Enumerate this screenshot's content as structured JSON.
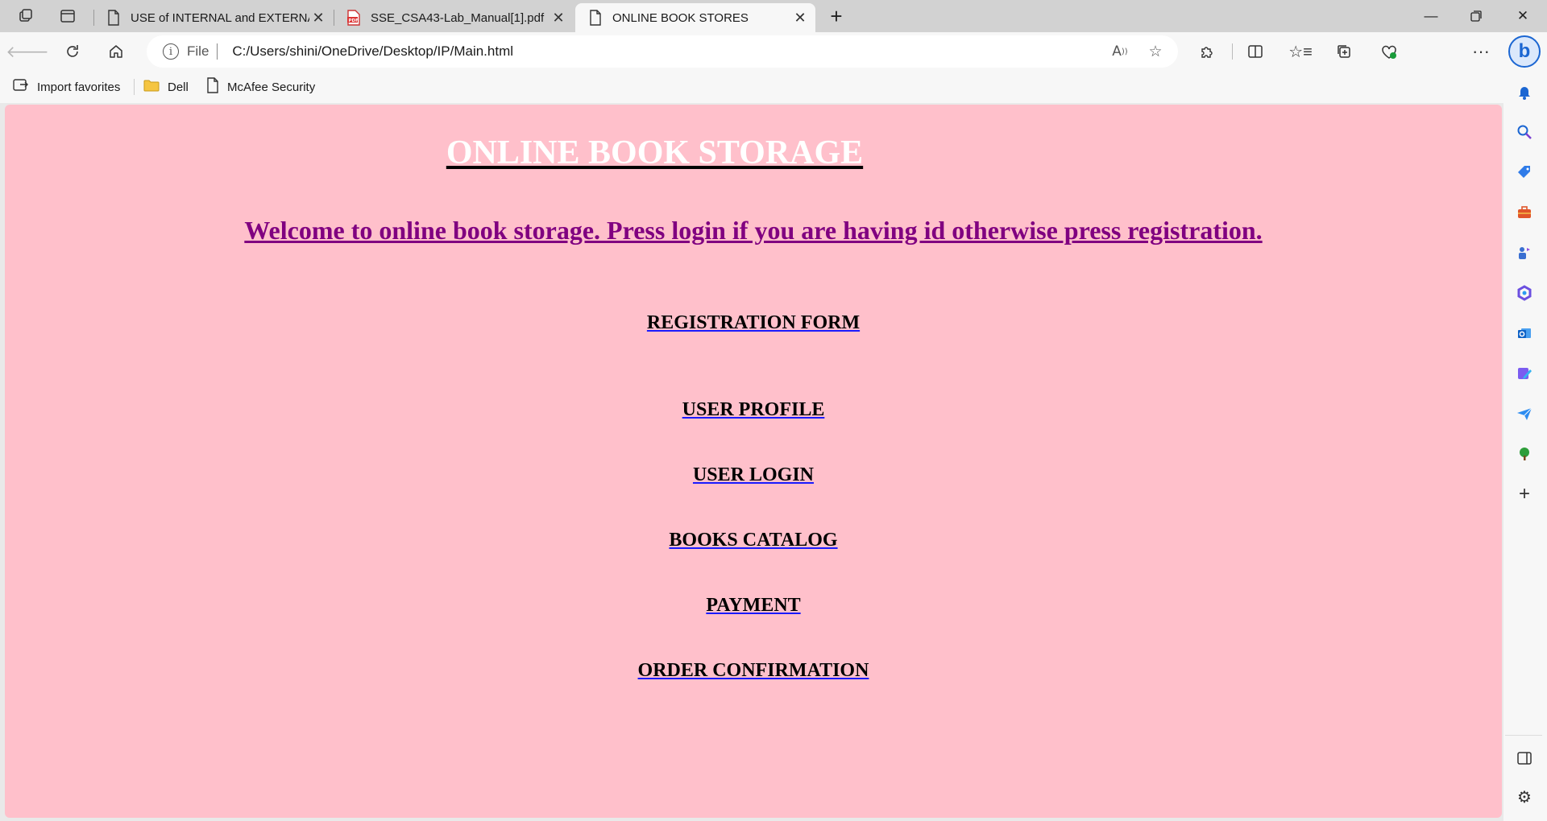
{
  "browser": {
    "tabs": [
      {
        "title": "USE of INTERNAL and EXTERNAL",
        "icon": "page-icon",
        "active": false
      },
      {
        "title": "SSE_CSA43-Lab_Manual[1].pdf",
        "icon": "pdf-icon",
        "active": false
      },
      {
        "title": "ONLINE BOOK STORES",
        "icon": "page-icon",
        "active": true
      }
    ],
    "address": {
      "scheme": "File",
      "url": "C:/Users/shini/OneDrive/Desktop/IP/Main.html"
    },
    "favorites": [
      {
        "label": "Import favorites",
        "icon": "import-icon"
      },
      {
        "label": "Dell",
        "icon": "folder-icon"
      },
      {
        "label": "McAfee Security",
        "icon": "page-icon"
      }
    ],
    "colors": {
      "page_background": "#ffc0cb",
      "welcome_text": "#800080",
      "link_underline": "#1a1aff"
    }
  },
  "page": {
    "title": "ONLINE BOOK STORAGE",
    "welcome": "Welcome to online book storage. Press login if you are having id otherwise press registration.",
    "links": [
      "REGISTRATION FORM",
      "USER PROFILE",
      "USER LOGIN",
      "BOOKS CATALOG",
      "PAYMENT",
      "ORDER CONFIRMATION"
    ]
  }
}
